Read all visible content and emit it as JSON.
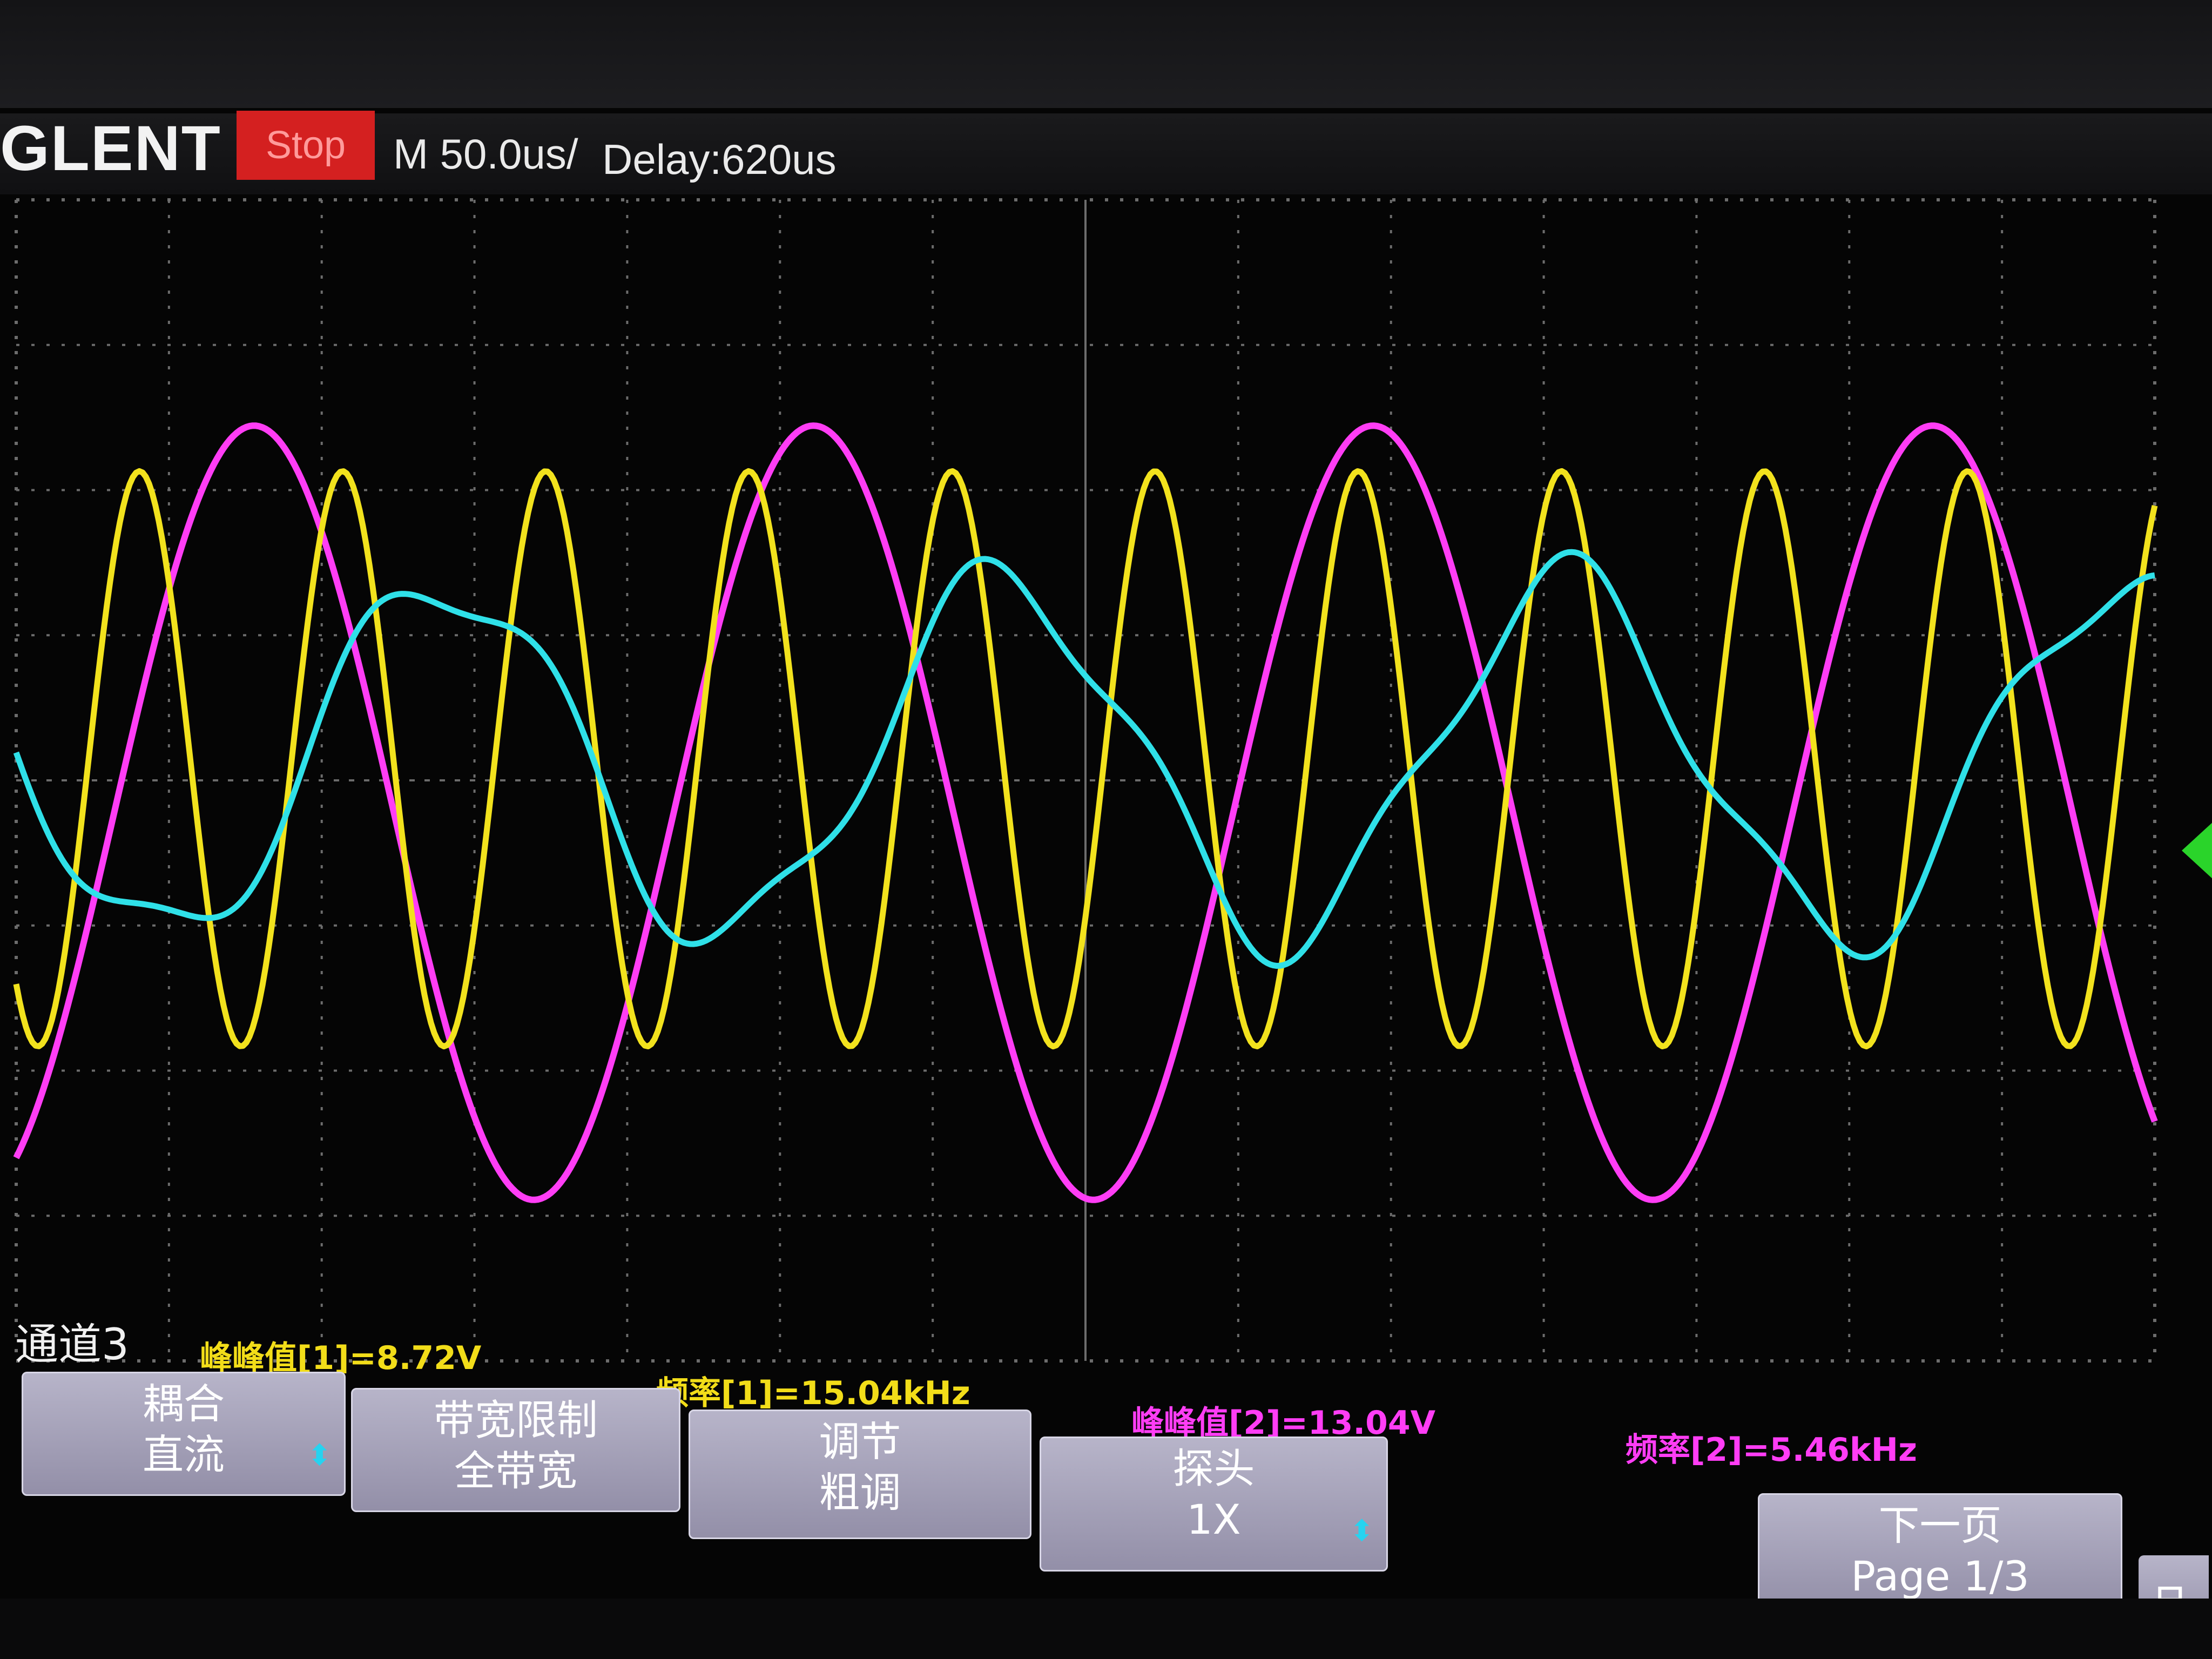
{
  "header": {
    "brand": "GLENT",
    "run_status": "Stop",
    "timebase": "M 50.0us/",
    "delay": "Delay:620us"
  },
  "channel_label": "通道3",
  "measurements": {
    "ch1_vpp": "峰峰值[1]=8.72V",
    "ch1_freq": "频率[1]=15.04kHz",
    "ch2_vpp": "峰峰值[2]=13.04V",
    "ch2_freq": "频率[2]=5.46kHz"
  },
  "softkeys": [
    {
      "line1": "耦合",
      "line2": "直流"
    },
    {
      "line1": "带宽限制",
      "line2": "全带宽"
    },
    {
      "line1": "调节",
      "line2": "粗调"
    },
    {
      "line1": "探头",
      "line2": "1X"
    },
    {
      "line1": "下一页",
      "line2": "Page 1/3"
    }
  ],
  "icons": {
    "softkey_arrow": "arrow-updown-icon",
    "network": "network-icon",
    "trigger_marker": "trigger-level-icon"
  },
  "colors": {
    "ch1": "#f2e21d",
    "ch2": "#ff3df5",
    "ch3": "#2fe0e8",
    "grid": "#6c6c6c",
    "stop": "#d42020"
  },
  "waveforms": {
    "ch1": {
      "freq_khz": 15.04,
      "vpp_v": 8.72
    },
    "ch2": {
      "freq_khz": 5.46,
      "vpp_v": 13.04
    }
  }
}
